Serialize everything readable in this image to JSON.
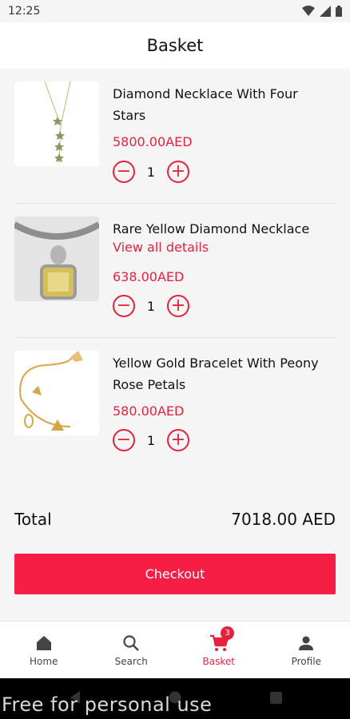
{
  "status_bar": {
    "time": "12:25"
  },
  "header": {
    "title": "Basket"
  },
  "items": [
    {
      "name": "Diamond Necklace With Four Stars",
      "price": "5800.00AED",
      "qty": "1"
    },
    {
      "name": "Rare Yellow Diamond Necklace",
      "link": "View all details",
      "price": "638.00AED",
      "qty": "1"
    },
    {
      "name": "Yellow Gold Bracelet With Peony Rose Petals",
      "price": "580.00AED",
      "qty": "1"
    }
  ],
  "total": {
    "label": "Total",
    "value": "7018.00 AED"
  },
  "checkout_label": "Checkout",
  "nav": [
    {
      "label": "Home",
      "icon": "home-icon"
    },
    {
      "label": "Search",
      "icon": "search-icon"
    },
    {
      "label": "Basket",
      "icon": "cart-icon",
      "badge": "3"
    },
    {
      "label": "Profile",
      "icon": "person-icon"
    }
  ],
  "watermark": "Free for personal use",
  "colors": {
    "accent": "#e8213f",
    "checkout_bg": "#f71e46"
  }
}
